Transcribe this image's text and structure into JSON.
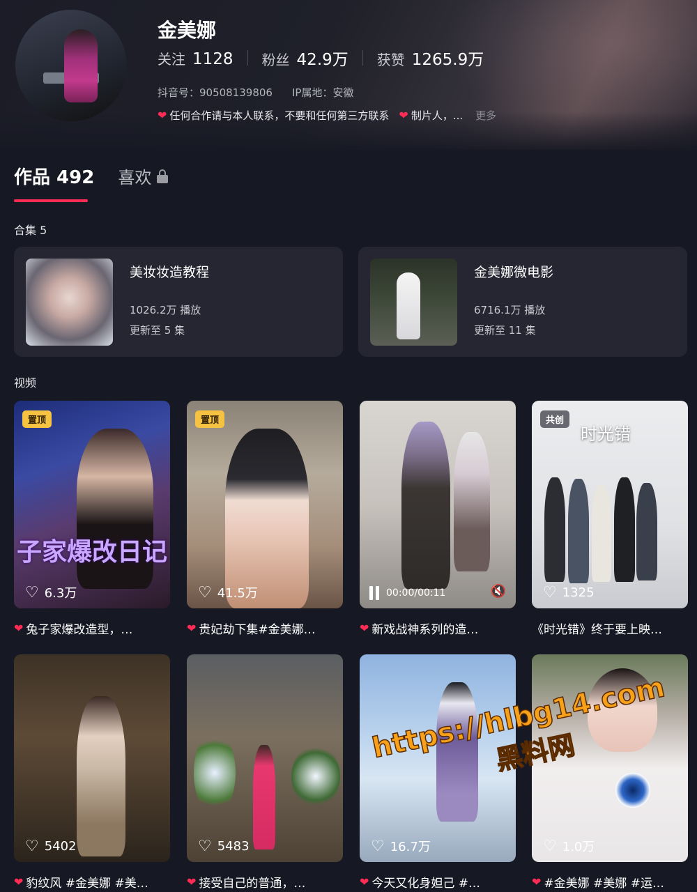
{
  "profile": {
    "name": "金美娜",
    "stats": [
      {
        "label": "关注",
        "value": "1128"
      },
      {
        "label": "粉丝",
        "value": "42.9万"
      },
      {
        "label": "获赞",
        "value": "1265.9万"
      }
    ],
    "douyin_id": "抖音号：90508139806",
    "ip_location": "IP属地：安徽",
    "bio": "任何合作请与本人联系，不要和任何第三方联系",
    "bio_tail": "制片人，...",
    "more_label": "更多"
  },
  "tabs": {
    "works_label": "作品 492",
    "likes_label": "喜欢"
  },
  "collections": {
    "section_label": "合集 5",
    "items": [
      {
        "title": "美妆妆造教程",
        "plays": "1026.2万 播放",
        "update": "更新至 5 集"
      },
      {
        "title": "金美娜微电影",
        "plays": "6716.1万 播放",
        "update": "更新至 11 集"
      }
    ]
  },
  "videos": {
    "section_label": "视频",
    "items": [
      {
        "badge": "置顶",
        "likes": "6.3万",
        "caption": "兔子家爆改造型，…",
        "overlay": "子家爆改日记"
      },
      {
        "badge": "置顶",
        "likes": "41.5万",
        "caption": "贵妃劫下集#金美娜…"
      },
      {
        "time": "00:00/00:11",
        "caption": "新戏战神系列的造…"
      },
      {
        "badge": "共创",
        "likes": "1325",
        "caption": "《时光错》终于要上映…",
        "overlay": "时光错"
      },
      {
        "likes": "5402",
        "caption": "豹纹风 #金美娜 #美…"
      },
      {
        "likes": "5483",
        "caption": "接受自己的普通，…"
      },
      {
        "likes": "16.7万",
        "caption": "今天又化身妲己 #…"
      },
      {
        "likes": "1.0万",
        "caption": "#金美娜 #美娜 #运…"
      }
    ]
  },
  "watermark": {
    "url": "https://hlbg14.com",
    "site": "黑料网"
  },
  "colors": {
    "background": "#161823",
    "accent": "#fe2c55",
    "pin_badge": "#f5c242"
  },
  "icons": [
    "heart-icon",
    "heart-outline-icon",
    "lock-icon",
    "pause-icon",
    "mute-icon"
  ]
}
